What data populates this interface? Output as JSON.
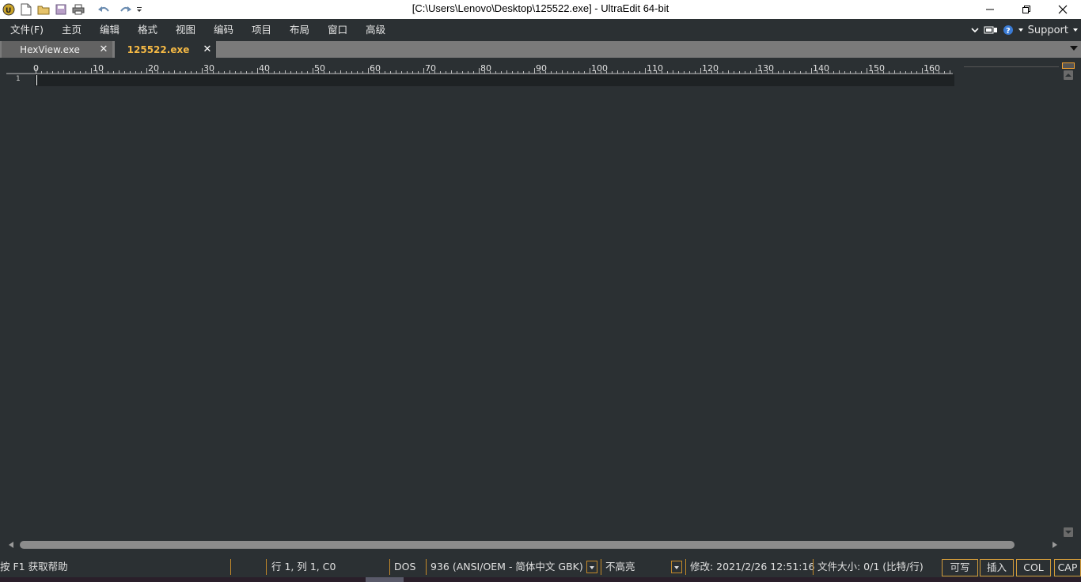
{
  "window": {
    "title": "[C:\\Users\\Lenovo\\Desktop\\125522.exe] - UltraEdit 64-bit",
    "quick_access_icons": [
      "app-logo-icon",
      "new-file-icon",
      "open-folder-icon",
      "save-icon",
      "print-icon",
      "undo-icon",
      "redo-icon",
      "customize-dropdown-icon"
    ],
    "controls": [
      "minimize-icon",
      "restore-icon",
      "close-icon"
    ]
  },
  "menu": {
    "items": [
      "文件(F)",
      "主页",
      "编辑",
      "格式",
      "视图",
      "编码",
      "项目",
      "布局",
      "窗口",
      "高级"
    ],
    "support_label": "Support"
  },
  "tabs": [
    {
      "label": "HexView.exe",
      "active": false
    },
    {
      "label": "125522.exe",
      "active": true
    }
  ],
  "ruler": {
    "labels": [
      "0",
      "10",
      "20",
      "30",
      "40",
      "50",
      "60",
      "70",
      "80",
      "90",
      "100",
      "110",
      "120",
      "130",
      "140",
      "150",
      "160"
    ]
  },
  "editor": {
    "line_numbers": [
      "1"
    ],
    "content": ""
  },
  "status": {
    "help": "按 F1 获取帮助",
    "position": "行 1, 列 1, C0",
    "line_ending": "DOS",
    "encoding": "936  (ANSI/OEM - 简体中文 GBK)",
    "highlight": "不高亮",
    "modified": "修改:  2021/2/26 12:51:16",
    "filesize": "文件大小:  0/1  (比特/行)",
    "writable": "可写",
    "insert": "插入",
    "col": "COL",
    "cap": "CAP"
  },
  "colors": {
    "background": "#2b3033",
    "active_tab_text": "#f5b945",
    "status_border": "#d19a3a"
  }
}
